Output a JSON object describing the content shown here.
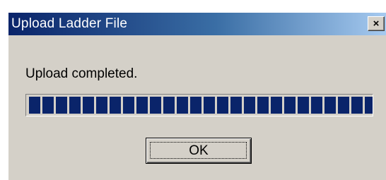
{
  "window": {
    "title": "Upload Ladder File",
    "close_label": "×"
  },
  "message": "Upload completed.",
  "progress": {
    "value_percent": 100,
    "color": "#0a246a"
  },
  "buttons": {
    "ok_label": "OK"
  },
  "colors": {
    "face": "#d4d0c8",
    "title_start": "#0a246a",
    "title_end": "#a6caf0"
  }
}
